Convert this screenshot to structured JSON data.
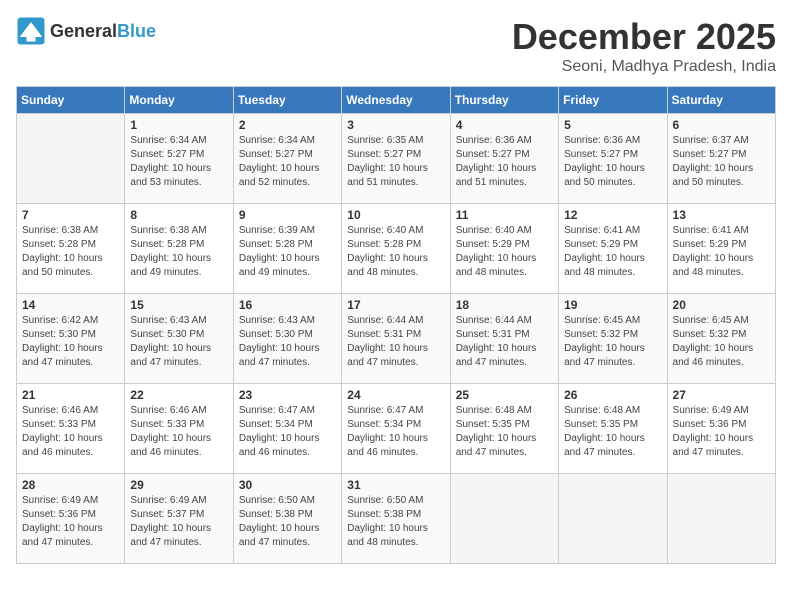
{
  "header": {
    "logo_general": "General",
    "logo_blue": "Blue",
    "month": "December 2025",
    "location": "Seoni, Madhya Pradesh, India"
  },
  "weekdays": [
    "Sunday",
    "Monday",
    "Tuesday",
    "Wednesday",
    "Thursday",
    "Friday",
    "Saturday"
  ],
  "weeks": [
    [
      {
        "day": "",
        "info": ""
      },
      {
        "day": "1",
        "info": "Sunrise: 6:34 AM\nSunset: 5:27 PM\nDaylight: 10 hours\nand 53 minutes."
      },
      {
        "day": "2",
        "info": "Sunrise: 6:34 AM\nSunset: 5:27 PM\nDaylight: 10 hours\nand 52 minutes."
      },
      {
        "day": "3",
        "info": "Sunrise: 6:35 AM\nSunset: 5:27 PM\nDaylight: 10 hours\nand 51 minutes."
      },
      {
        "day": "4",
        "info": "Sunrise: 6:36 AM\nSunset: 5:27 PM\nDaylight: 10 hours\nand 51 minutes."
      },
      {
        "day": "5",
        "info": "Sunrise: 6:36 AM\nSunset: 5:27 PM\nDaylight: 10 hours\nand 50 minutes."
      },
      {
        "day": "6",
        "info": "Sunrise: 6:37 AM\nSunset: 5:27 PM\nDaylight: 10 hours\nand 50 minutes."
      }
    ],
    [
      {
        "day": "7",
        "info": "Sunrise: 6:38 AM\nSunset: 5:28 PM\nDaylight: 10 hours\nand 50 minutes."
      },
      {
        "day": "8",
        "info": "Sunrise: 6:38 AM\nSunset: 5:28 PM\nDaylight: 10 hours\nand 49 minutes."
      },
      {
        "day": "9",
        "info": "Sunrise: 6:39 AM\nSunset: 5:28 PM\nDaylight: 10 hours\nand 49 minutes."
      },
      {
        "day": "10",
        "info": "Sunrise: 6:40 AM\nSunset: 5:28 PM\nDaylight: 10 hours\nand 48 minutes."
      },
      {
        "day": "11",
        "info": "Sunrise: 6:40 AM\nSunset: 5:29 PM\nDaylight: 10 hours\nand 48 minutes."
      },
      {
        "day": "12",
        "info": "Sunrise: 6:41 AM\nSunset: 5:29 PM\nDaylight: 10 hours\nand 48 minutes."
      },
      {
        "day": "13",
        "info": "Sunrise: 6:41 AM\nSunset: 5:29 PM\nDaylight: 10 hours\nand 48 minutes."
      }
    ],
    [
      {
        "day": "14",
        "info": "Sunrise: 6:42 AM\nSunset: 5:30 PM\nDaylight: 10 hours\nand 47 minutes."
      },
      {
        "day": "15",
        "info": "Sunrise: 6:43 AM\nSunset: 5:30 PM\nDaylight: 10 hours\nand 47 minutes."
      },
      {
        "day": "16",
        "info": "Sunrise: 6:43 AM\nSunset: 5:30 PM\nDaylight: 10 hours\nand 47 minutes."
      },
      {
        "day": "17",
        "info": "Sunrise: 6:44 AM\nSunset: 5:31 PM\nDaylight: 10 hours\nand 47 minutes."
      },
      {
        "day": "18",
        "info": "Sunrise: 6:44 AM\nSunset: 5:31 PM\nDaylight: 10 hours\nand 47 minutes."
      },
      {
        "day": "19",
        "info": "Sunrise: 6:45 AM\nSunset: 5:32 PM\nDaylight: 10 hours\nand 47 minutes."
      },
      {
        "day": "20",
        "info": "Sunrise: 6:45 AM\nSunset: 5:32 PM\nDaylight: 10 hours\nand 46 minutes."
      }
    ],
    [
      {
        "day": "21",
        "info": "Sunrise: 6:46 AM\nSunset: 5:33 PM\nDaylight: 10 hours\nand 46 minutes."
      },
      {
        "day": "22",
        "info": "Sunrise: 6:46 AM\nSunset: 5:33 PM\nDaylight: 10 hours\nand 46 minutes."
      },
      {
        "day": "23",
        "info": "Sunrise: 6:47 AM\nSunset: 5:34 PM\nDaylight: 10 hours\nand 46 minutes."
      },
      {
        "day": "24",
        "info": "Sunrise: 6:47 AM\nSunset: 5:34 PM\nDaylight: 10 hours\nand 46 minutes."
      },
      {
        "day": "25",
        "info": "Sunrise: 6:48 AM\nSunset: 5:35 PM\nDaylight: 10 hours\nand 47 minutes."
      },
      {
        "day": "26",
        "info": "Sunrise: 6:48 AM\nSunset: 5:35 PM\nDaylight: 10 hours\nand 47 minutes."
      },
      {
        "day": "27",
        "info": "Sunrise: 6:49 AM\nSunset: 5:36 PM\nDaylight: 10 hours\nand 47 minutes."
      }
    ],
    [
      {
        "day": "28",
        "info": "Sunrise: 6:49 AM\nSunset: 5:36 PM\nDaylight: 10 hours\nand 47 minutes."
      },
      {
        "day": "29",
        "info": "Sunrise: 6:49 AM\nSunset: 5:37 PM\nDaylight: 10 hours\nand 47 minutes."
      },
      {
        "day": "30",
        "info": "Sunrise: 6:50 AM\nSunset: 5:38 PM\nDaylight: 10 hours\nand 47 minutes."
      },
      {
        "day": "31",
        "info": "Sunrise: 6:50 AM\nSunset: 5:38 PM\nDaylight: 10 hours\nand 48 minutes."
      },
      {
        "day": "",
        "info": ""
      },
      {
        "day": "",
        "info": ""
      },
      {
        "day": "",
        "info": ""
      }
    ]
  ]
}
